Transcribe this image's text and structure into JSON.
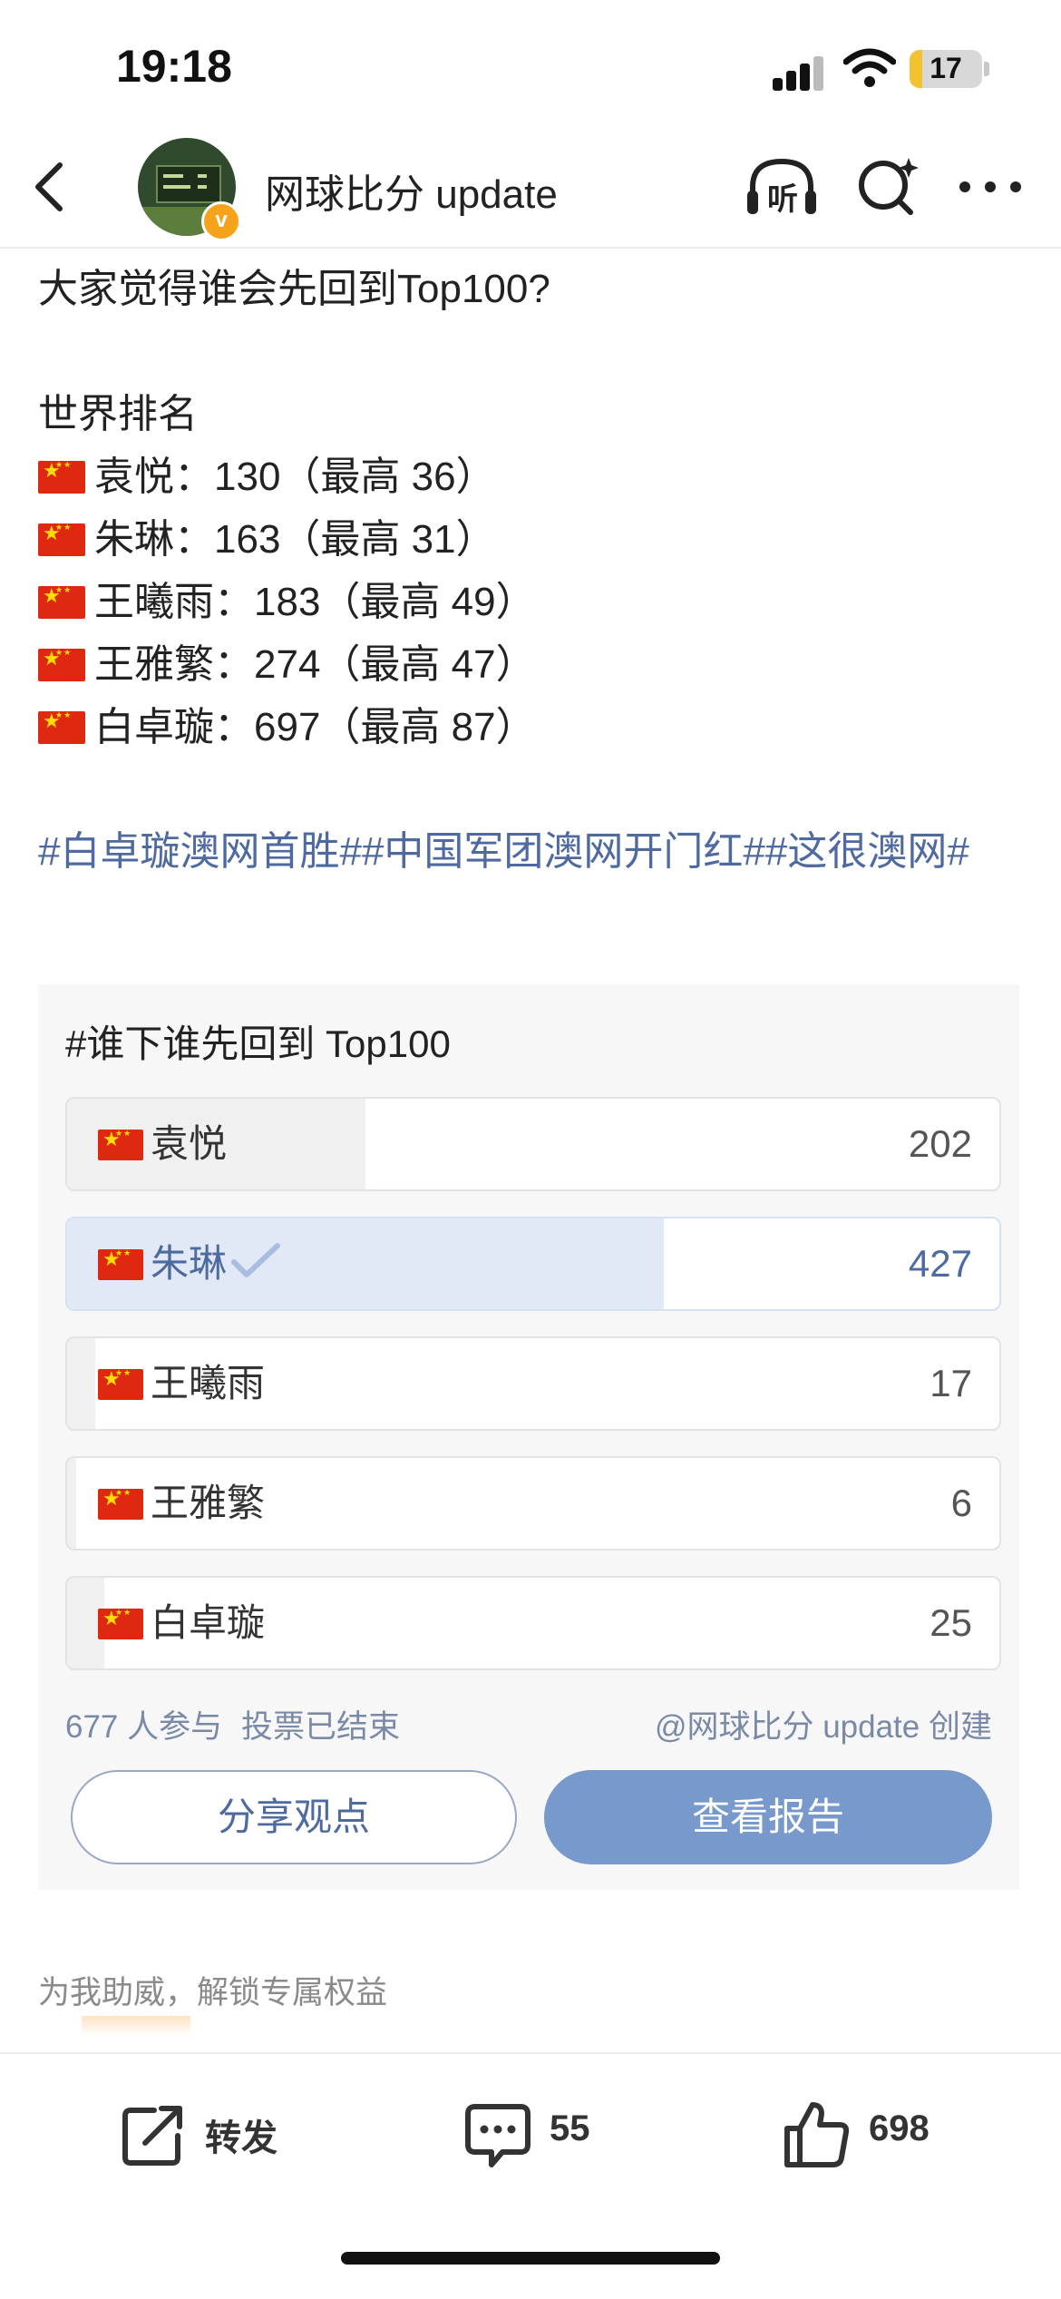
{
  "status_bar": {
    "time": "19:18",
    "battery": "17"
  },
  "nav": {
    "account_name": "网球比分 update",
    "listen_label": "听"
  },
  "post": {
    "question": "大家觉得谁会先回到Top100?",
    "section_title": "世界排名",
    "rankings": [
      "袁悦：130（最高 36）",
      "朱琳：163（最高 31）",
      "王曦雨：183（最高 49）",
      "王雅繁：274（最高 47）",
      "白卓璇：697（最高 87）"
    ],
    "hashtags": "#白卓璇澳网首胜##中国军团澳网开门红##这很澳网#"
  },
  "poll": {
    "title": "#谁下谁先回到 Top100",
    "options": [
      {
        "label": "袁悦",
        "count": "202",
        "share": 0.32,
        "selected": false
      },
      {
        "label": "朱琳",
        "count": "427",
        "share": 0.64,
        "selected": true
      },
      {
        "label": "王曦雨",
        "count": "17",
        "share": 0.03,
        "selected": false
      },
      {
        "label": "王雅繁",
        "count": "6",
        "share": 0.01,
        "selected": false
      },
      {
        "label": "白卓璇",
        "count": "25",
        "share": 0.04,
        "selected": false
      }
    ],
    "participants": "677 人参与",
    "status": "投票已结束",
    "creator": "@网球比分 update",
    "creator_suffix": "创建",
    "share_button": "分享观点",
    "report_button": "查看报告"
  },
  "support_text": "为我助威，解锁专属权益",
  "bottom_bar": {
    "repost_label": "转发",
    "comments_count": "55",
    "likes_count": "698"
  },
  "colors": {
    "link": "#4e6aa0",
    "poll_selected": "#e2e9f6",
    "report_button": "#7799cc",
    "verified_badge": "#f7a21b"
  }
}
